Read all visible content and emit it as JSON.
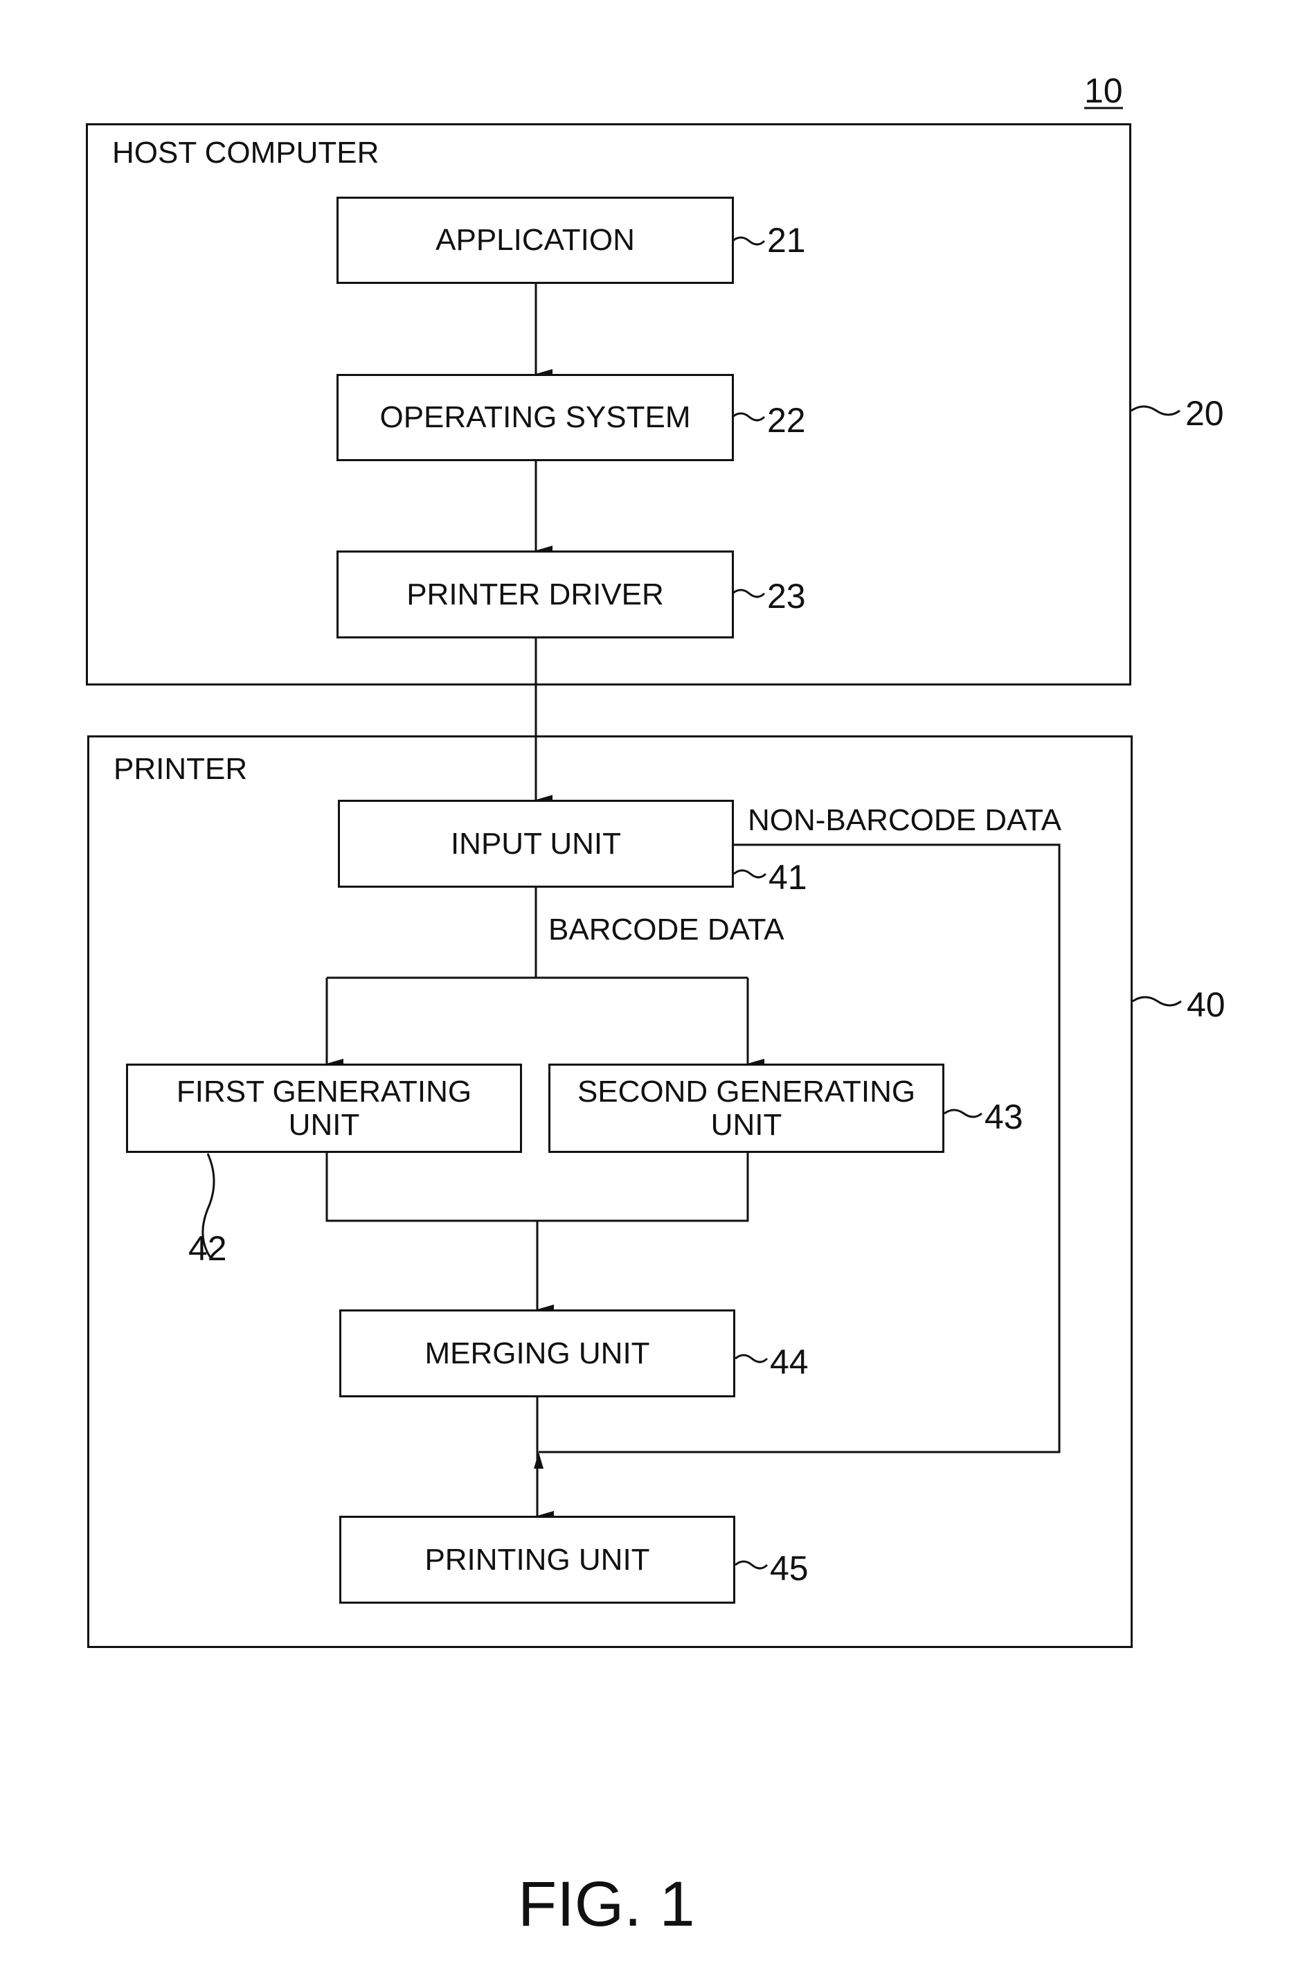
{
  "figure": {
    "ref_main": "10",
    "caption": "FIG. 1"
  },
  "host": {
    "title": "HOST COMPUTER",
    "ref": "20",
    "blocks": [
      {
        "label": "APPLICATION",
        "ref": "21"
      },
      {
        "label": "OPERATING SYSTEM",
        "ref": "22"
      },
      {
        "label": "PRINTER DRIVER",
        "ref": "23"
      }
    ]
  },
  "printer": {
    "title": "PRINTER",
    "ref": "40",
    "input": {
      "label": "INPUT UNIT",
      "ref": "41"
    },
    "first_gen": {
      "label": "FIRST GENERATING UNIT",
      "ref": "42"
    },
    "second_gen": {
      "label": "SECOND GENERATING UNIT",
      "ref": "43"
    },
    "merging": {
      "label": "MERGING UNIT",
      "ref": "44"
    },
    "printing": {
      "label": "PRINTING UNIT",
      "ref": "45"
    },
    "edge_labels": {
      "non_barcode": "NON-BARCODE DATA",
      "barcode": "BARCODE DATA"
    }
  }
}
